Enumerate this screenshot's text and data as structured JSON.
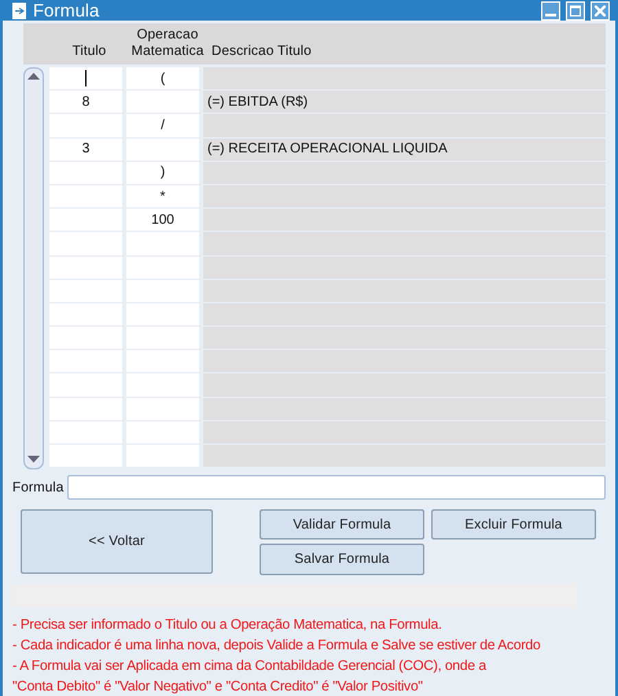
{
  "window": {
    "title": "Formula"
  },
  "grid": {
    "columns": [
      "Titulo",
      "Operacao Matematica",
      "Descricao Titulo"
    ],
    "rows": [
      {
        "titulo": "",
        "operacao": "(",
        "descricao": "",
        "focused": true
      },
      {
        "titulo": "8",
        "operacao": "",
        "descricao": "(=) EBITDA (R$)",
        "focused": false
      },
      {
        "titulo": "",
        "operacao": "/",
        "descricao": "",
        "focused": false
      },
      {
        "titulo": "3",
        "operacao": "",
        "descricao": "(=) RECEITA OPERACIONAL LIQUIDA",
        "focused": false
      },
      {
        "titulo": "",
        "operacao": ")",
        "descricao": "",
        "focused": false
      },
      {
        "titulo": "",
        "operacao": "*",
        "descricao": "",
        "focused": false
      },
      {
        "titulo": "",
        "operacao": "100",
        "descricao": "",
        "focused": false
      },
      {
        "titulo": "",
        "operacao": "",
        "descricao": "",
        "focused": false
      },
      {
        "titulo": "",
        "operacao": "",
        "descricao": "",
        "focused": false
      },
      {
        "titulo": "",
        "operacao": "",
        "descricao": "",
        "focused": false
      },
      {
        "titulo": "",
        "operacao": "",
        "descricao": "",
        "focused": false
      },
      {
        "titulo": "",
        "operacao": "",
        "descricao": "",
        "focused": false
      },
      {
        "titulo": "",
        "operacao": "",
        "descricao": "",
        "focused": false
      },
      {
        "titulo": "",
        "operacao": "",
        "descricao": "",
        "focused": false
      },
      {
        "titulo": "",
        "operacao": "",
        "descricao": "",
        "focused": false
      },
      {
        "titulo": "",
        "operacao": "",
        "descricao": "",
        "focused": false
      },
      {
        "titulo": "",
        "operacao": "",
        "descricao": "",
        "focused": false
      }
    ]
  },
  "formula": {
    "label": "Formula"
  },
  "buttons": {
    "back": "<< Voltar",
    "validate": "Validar Formula",
    "delete": "Excluir Formula",
    "save": "Salvar Formula"
  },
  "notes": [
    "- Precisa ser informado o Titulo ou a Operação Matematica, na Formula.",
    "- Cada indicador é uma linha nova, depois Valide a Formula e Salve se estiver de Acordo",
    "- A Formula vai ser Aplicada em cima da Contabildade Gerencial (COC), onde a",
    "\"Conta Debito\" é \"Valor Negativo\" e \"Conta Credito\" é \"Valor Positivo\""
  ]
}
